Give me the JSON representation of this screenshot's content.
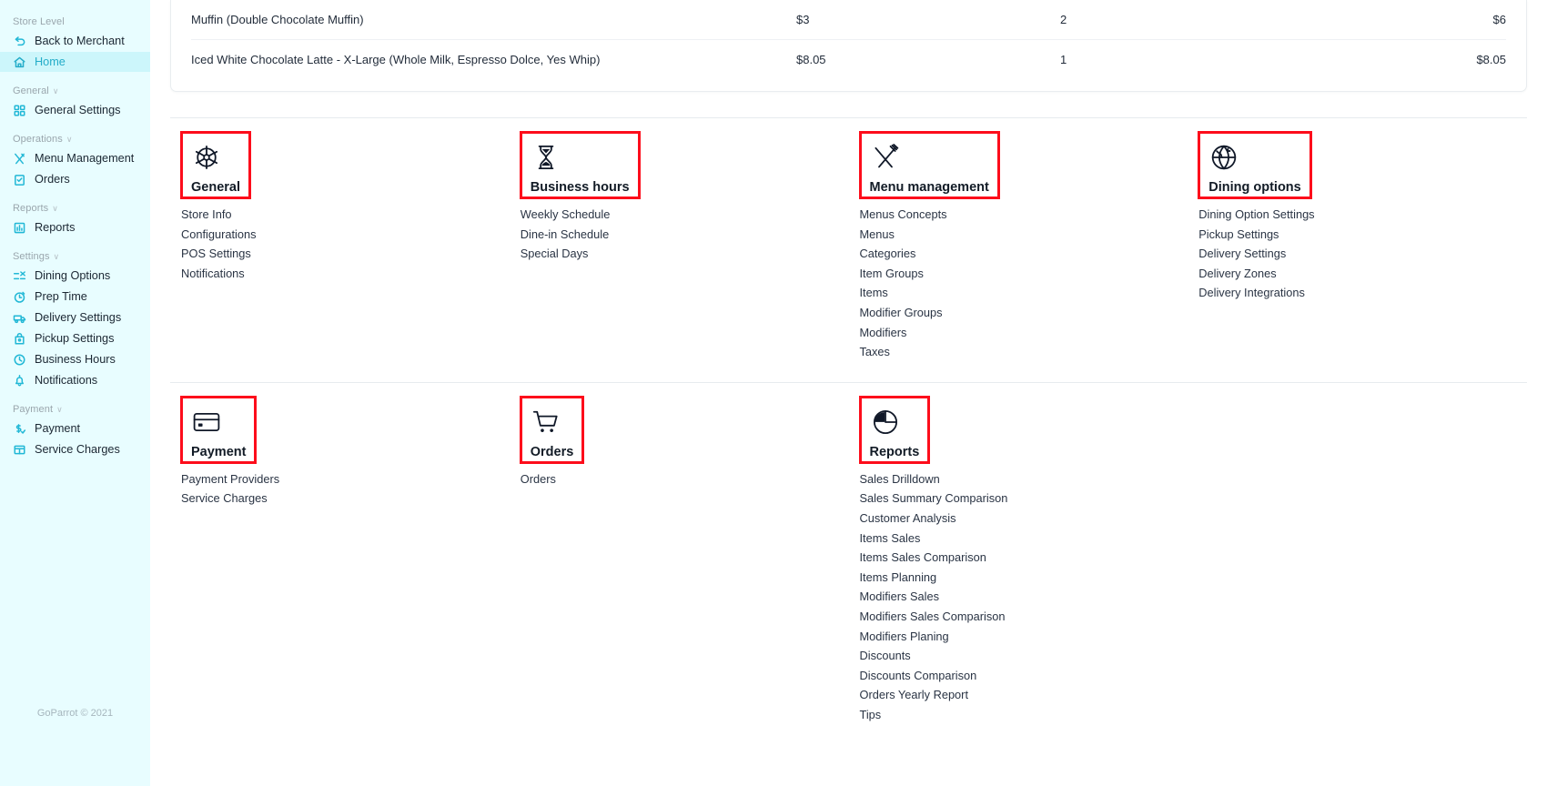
{
  "sidebar": {
    "groups": [
      {
        "label": "Store Level",
        "collapsible": false,
        "items": [
          {
            "label": "Back to Merchant",
            "icon": "back-arrow-icon",
            "active": false
          },
          {
            "label": "Home",
            "icon": "home-icon",
            "active": true
          }
        ]
      },
      {
        "label": "General",
        "collapsible": true,
        "items": [
          {
            "label": "General Settings",
            "icon": "grid-squares-icon",
            "active": false
          }
        ]
      },
      {
        "label": "Operations",
        "collapsible": true,
        "items": [
          {
            "label": "Menu Management",
            "icon": "cutlery-icon",
            "active": false
          },
          {
            "label": "Orders",
            "icon": "clipboard-check-icon",
            "active": false
          }
        ]
      },
      {
        "label": "Reports",
        "collapsible": true,
        "items": [
          {
            "label": "Reports",
            "icon": "bar-chart-icon",
            "active": false
          }
        ]
      },
      {
        "label": "Settings",
        "collapsible": true,
        "items": [
          {
            "label": "Dining Options",
            "icon": "sliders-icon",
            "active": false
          },
          {
            "label": "Prep Time",
            "icon": "stopwatch-icon",
            "active": false
          },
          {
            "label": "Delivery Settings",
            "icon": "delivery-truck-icon",
            "active": false
          },
          {
            "label": "Pickup Settings",
            "icon": "pickup-bag-icon",
            "active": false
          },
          {
            "label": "Business Hours",
            "icon": "clock-icon",
            "active": false
          },
          {
            "label": "Notifications",
            "icon": "bell-icon",
            "active": false
          }
        ]
      },
      {
        "label": "Payment",
        "collapsible": true,
        "items": [
          {
            "label": "Payment",
            "icon": "dollar-check-icon",
            "active": false
          },
          {
            "label": "Service Charges",
            "icon": "receipt-grid-icon",
            "active": false
          }
        ]
      }
    ],
    "footer": "GoParrot © 2021"
  },
  "order_table": {
    "rows": [
      {
        "name": "Muffin (Double Chocolate Muffin)",
        "price": "$3",
        "qty": "2",
        "total": "$6"
      },
      {
        "name": "Iced White Chocolate Latte - X-Large (Whole Milk, Espresso Dolce, Yes Whip)",
        "price": "$8.05",
        "qty": "1",
        "total": "$8.05"
      }
    ]
  },
  "highlight_color": "#fd0d1b",
  "sections": {
    "row1": [
      {
        "title": "General",
        "icon": "gear-icon",
        "highlighted": true,
        "links": [
          "Store Info",
          "Configurations",
          "POS Settings",
          "Notifications"
        ]
      },
      {
        "title": "Business hours",
        "icon": "hourglass-icon",
        "highlighted": true,
        "links": [
          "Weekly Schedule",
          "Dine-in Schedule",
          "Special Days"
        ]
      },
      {
        "title": "Menu management",
        "icon": "fork-knife-icon",
        "highlighted": true,
        "links": [
          "Menus Concepts",
          "Menus",
          "Categories",
          "Item Groups",
          "Items",
          "Modifier Groups",
          "Modifiers",
          "Taxes"
        ]
      },
      {
        "title": "Dining options",
        "icon": "globe-icon",
        "highlighted": true,
        "links": [
          "Dining Option Settings",
          "Pickup Settings",
          "Delivery Settings",
          "Delivery Zones",
          "Delivery Integrations"
        ]
      }
    ],
    "row2": [
      {
        "title": "Payment",
        "icon": "credit-card-icon",
        "highlighted": true,
        "links": [
          "Payment Providers",
          "Service Charges"
        ]
      },
      {
        "title": "Orders",
        "icon": "shopping-cart-icon",
        "highlighted": true,
        "links": [
          "Orders"
        ]
      },
      {
        "title": "Reports",
        "icon": "pie-chart-icon",
        "highlighted": true,
        "links": [
          "Sales Drilldown",
          "Sales Summary Comparison",
          "Customer Analysis",
          "Items Sales",
          "Items Sales Comparison",
          "Items Planning",
          "Modifiers Sales",
          "Modifiers Sales Comparison",
          "Modifiers Planing",
          "Discounts",
          "Discounts Comparison",
          "Orders Yearly Report",
          "Tips"
        ]
      },
      {
        "title": "",
        "icon": "",
        "highlighted": false,
        "links": []
      }
    ]
  }
}
